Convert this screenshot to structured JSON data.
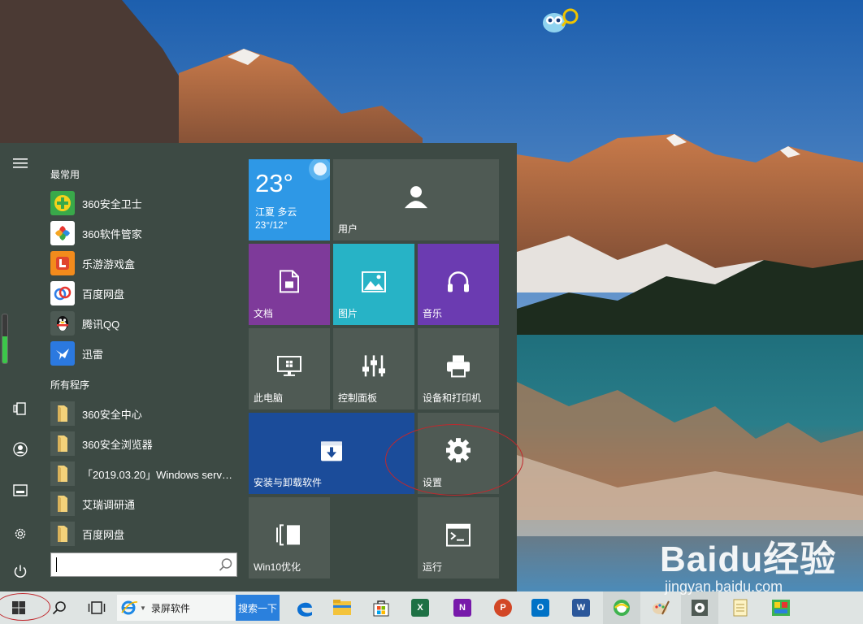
{
  "start_menu": {
    "section_frequent": "最常用",
    "section_all": "所有程序",
    "frequent_apps": [
      {
        "label": "360安全卫士",
        "icon": "360-safeguard-icon"
      },
      {
        "label": "360软件管家",
        "icon": "360-software-manager-icon"
      },
      {
        "label": "乐游游戏盒",
        "icon": "leyou-game-box-icon"
      },
      {
        "label": "百度网盘",
        "icon": "baidu-netdisk-icon"
      },
      {
        "label": "腾讯QQ",
        "icon": "qq-penguin-icon"
      },
      {
        "label": "迅雷",
        "icon": "xunlei-bird-icon"
      }
    ],
    "all_programs": [
      {
        "label": "360安全中心",
        "icon": "folder-icon"
      },
      {
        "label": "360安全浏览器",
        "icon": "folder-icon"
      },
      {
        "label": "「2019.03.20」Windows server...",
        "icon": "folder-icon"
      },
      {
        "label": "艾瑞调研通",
        "icon": "folder-icon"
      },
      {
        "label": "百度网盘",
        "icon": "folder-icon"
      }
    ],
    "search": {
      "value": "",
      "placeholder": ""
    },
    "scroll_level": 0.55
  },
  "tiles": {
    "weather": {
      "temp": "23°",
      "location": "江夏 多云",
      "range": "23°/12°"
    },
    "user": "用户",
    "documents": "文档",
    "pictures": "图片",
    "music": "音乐",
    "this_pc": "此电脑",
    "control_panel": "控制面板",
    "devices_printers": "设备和打印机",
    "install_uninstall": "安装与卸载软件",
    "settings": "设置",
    "win10_optimize": "Win10优化",
    "run": "运行"
  },
  "taskbar": {
    "search_text": "录屏软件",
    "search_button": "搜索一下",
    "apps": [
      "edge-icon",
      "file-explorer-icon",
      "store-icon",
      "excel-icon",
      "onenote-icon",
      "powerpoint-icon",
      "outlook-icon",
      "word-icon",
      "360-browser-icon",
      "paint-icon",
      "settings-icon",
      "notepad-icon",
      "image-viewer-icon"
    ]
  },
  "watermark": {
    "logo": "Baidu经验",
    "url": "jingyan.baidu.com"
  },
  "colors": {
    "start_bg": "#3d4a44",
    "tile_gray": "#4f5a54",
    "weather_blue": "#2e98e6",
    "documents_purple": "#7e3a9a",
    "pictures_teal": "#27b3c6",
    "music_violet": "#6b3bb1",
    "install_navy": "#1b4c9a",
    "annotation_red": "#c0282d"
  }
}
